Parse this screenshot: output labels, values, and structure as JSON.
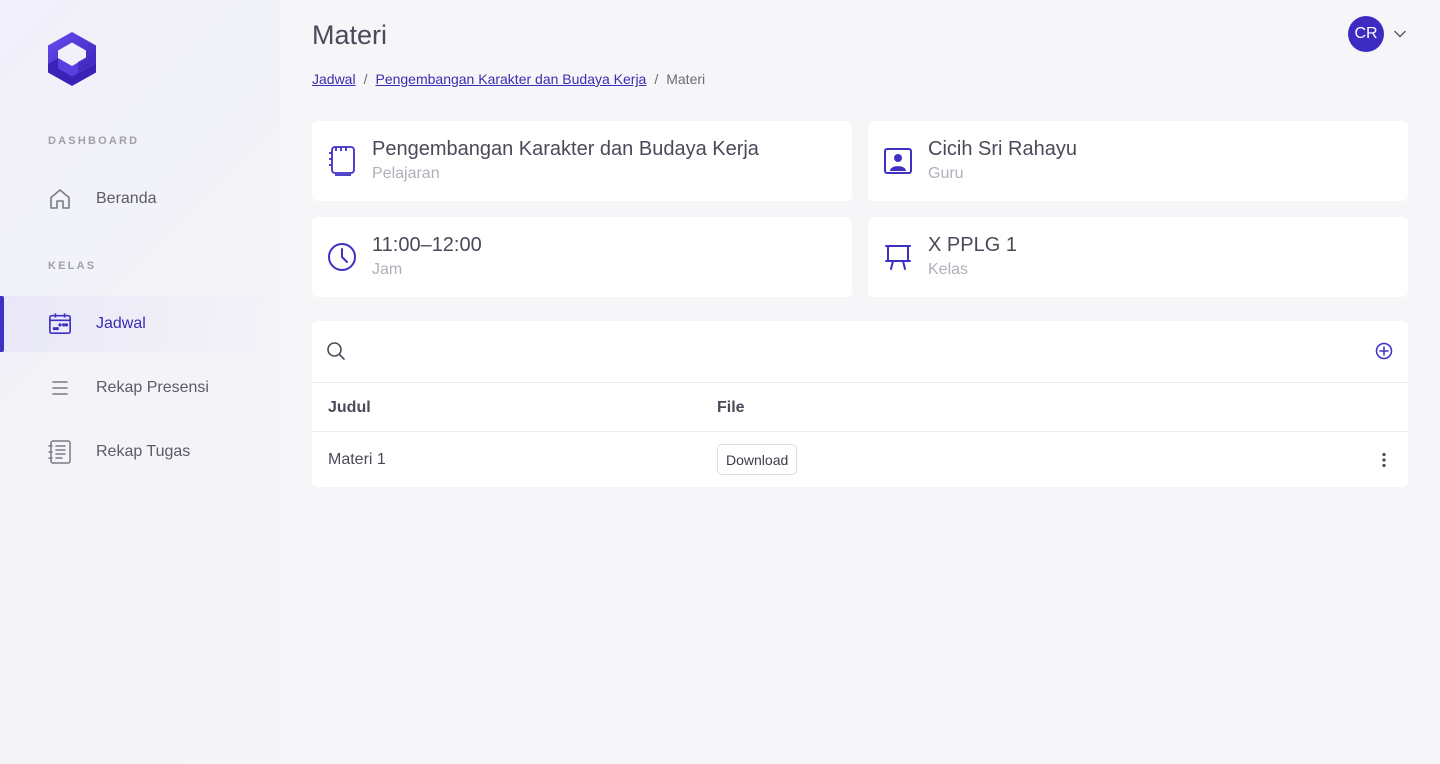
{
  "sidebar": {
    "sections": [
      {
        "label": "DASHBOARD"
      },
      {
        "label": "KELAS"
      }
    ],
    "items": [
      {
        "label": "Beranda",
        "icon": "home-icon"
      },
      {
        "label": "Jadwal",
        "icon": "calendar-icon",
        "active": true
      },
      {
        "label": "Rekap Presensi",
        "icon": "list-icon"
      },
      {
        "label": "Rekap Tugas",
        "icon": "document-list-icon"
      }
    ]
  },
  "header": {
    "title": "Materi",
    "breadcrumb": {
      "items": [
        "Jadwal",
        "Pengembangan Karakter dan Budaya Kerja"
      ],
      "current": "Materi",
      "separator": "/"
    },
    "avatar_initials": "CR"
  },
  "info_cards": [
    {
      "value": "Pengembangan Karakter dan Budaya Kerja",
      "label": "Pelajaran",
      "icon": "notebook-icon"
    },
    {
      "value": "Cicih Sri Rahayu",
      "label": "Guru",
      "icon": "user-board-icon"
    },
    {
      "value": "11:00–12:00",
      "label": "Jam",
      "icon": "clock-icon"
    },
    {
      "value": "X PPLG 1",
      "label": "Kelas",
      "icon": "easel-icon"
    }
  ],
  "table": {
    "search_placeholder": "",
    "columns": [
      "Judul",
      "File"
    ],
    "rows": [
      {
        "judul": "Materi 1",
        "file_button": "Download"
      }
    ]
  },
  "colors": {
    "accent": "#3f30c4",
    "background": "#f6f6f9",
    "card": "#ffffff"
  }
}
